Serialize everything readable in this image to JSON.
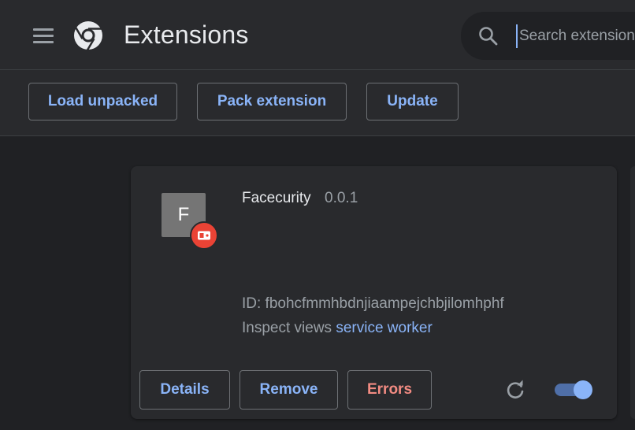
{
  "header": {
    "title": "Extensions",
    "search_placeholder": "Search extensions"
  },
  "toolbar": {
    "load_unpacked": "Load unpacked",
    "pack_extension": "Pack extension",
    "update": "Update"
  },
  "extension": {
    "icon_letter": "F",
    "name": "Facecurity",
    "version": "0.0.1",
    "id_text": "ID: fbohcfmmhbdnjiaampejchbjilomhphf",
    "inspect_label": "Inspect views",
    "inspect_link": "service worker",
    "details_label": "Details",
    "remove_label": "Remove",
    "errors_label": "Errors",
    "enabled": true
  },
  "colors": {
    "background": "#202124",
    "surface": "#292a2d",
    "accent": "#8ab4f8",
    "error": "#f28b82",
    "badge": "#ea4335"
  },
  "icons": {
    "menu": "hamburger-menu-icon",
    "logo": "chrome-logo-icon",
    "search": "search-icon",
    "badge": "service-worker-badge-icon",
    "reload": "reload-icon"
  }
}
